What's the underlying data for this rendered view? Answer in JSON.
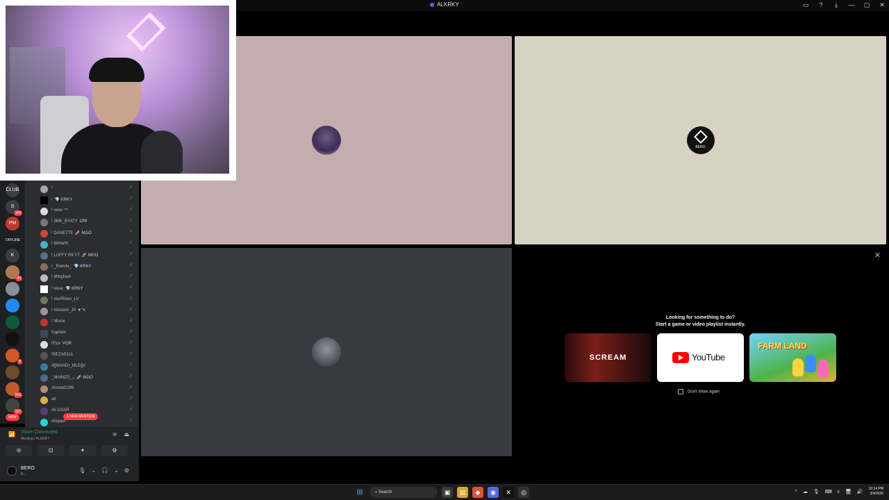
{
  "window": {
    "title": "ALKRKY",
    "controls": [
      "▭",
      "?",
      "⤓",
      "—",
      "▢",
      "✕"
    ]
  },
  "servers": [
    {
      "label": "CLUB",
      "badge": ""
    },
    {
      "label": "S",
      "badge": "143"
    },
    {
      "label": "PM",
      "badge": ""
    },
    {
      "label": "OFFLINE",
      "badge": ""
    },
    {
      "label": "K",
      "badge": ""
    },
    {
      "label": "",
      "badge": "43"
    },
    {
      "label": "",
      "badge": ""
    },
    {
      "label": "",
      "badge": ""
    },
    {
      "label": "",
      "badge": ""
    },
    {
      "label": "",
      "badge": ""
    },
    {
      "label": "",
      "badge": "8"
    },
    {
      "label": "",
      "badge": ""
    },
    {
      "label": "",
      "badge": "243"
    },
    {
      "label": "",
      "badge": "107"
    },
    {
      "label": "NEW",
      "badge": ""
    }
  ],
  "members": [
    {
      "name": "!",
      "tag": ""
    },
    {
      "name": "!",
      "tag": "💎 KRKY"
    },
    {
      "name": "! ʜᴀᴅᴏ ™",
      "tag": ""
    },
    {
      "name": "! 3MK_BYATY",
      "tag": "ORI"
    },
    {
      "name": "! DANETTE",
      "tag": "🚀 MGO"
    },
    {
      "name": "! tikHarth",
      "tag": ""
    },
    {
      "name": "! LUFFY R9 YT",
      "tag": "🚀 MGO"
    },
    {
      "name": "! _Ram4x_",
      "tag": "💎 KRKY"
    },
    {
      "name": "! dhirgham",
      "tag": ""
    },
    {
      "name": "! rexar",
      "tag": "💎 KRKY"
    },
    {
      "name": "! xxx/Rixen_LV",
      "tag": ""
    },
    {
      "name": "! Hussein_JP",
      "tag": "♥ *x"
    },
    {
      "name": "! Morse",
      "tag": ""
    },
    {
      "name": "!captain",
      "tag": ""
    },
    {
      "name": "!Flux",
      "tag": "VOR"
    },
    {
      "name": "!SEZAR1x1",
      "tag": ""
    },
    {
      "name": "#[[MAHDI_MLG]]#",
      "tag": ""
    },
    {
      "name": "_MAlNZO_ــ",
      "tag": "🚀 MGO"
    },
    {
      "name": "Ahmed1099",
      "tag": ""
    },
    {
      "name": "ali",
      "tag": ""
    },
    {
      "name": "Ali GXAR",
      "tag": ""
    },
    {
      "name": "Alioped",
      "tag": ""
    }
  ],
  "new_mention": "1 NEW MENTION",
  "voice": {
    "status": "Voice Connected",
    "channel": "Meeting / ALKRKY",
    "signal_icon": "📶",
    "right_icons": [
      "≋",
      "⏏"
    ],
    "buttons": [
      "⊘",
      "⊡",
      "✦",
      "⚙"
    ]
  },
  "user": {
    "name": "BERO",
    "status": "B...",
    "controls": [
      "🎙",
      "⌄",
      "🎧",
      "⌄",
      "⚙"
    ]
  },
  "tiles": {
    "bero_avatar_label": "BERO"
  },
  "activity": {
    "close": "✕",
    "heading_line1": "Looking for something to do?",
    "heading_line2": "Start a game or video playlist instantly.",
    "cards": {
      "scream": "SCREAM",
      "scream_date": "",
      "youtube": "YouTube",
      "farm": "FARM LAND"
    },
    "dont_show": "Don't show again"
  },
  "taskbar": {
    "search": "Search",
    "time": "10:14 PM",
    "date": "3/4/2026",
    "tray": [
      "^",
      "☁",
      "🎙",
      "⌨",
      "ε",
      "🖥",
      "🔊"
    ]
  }
}
